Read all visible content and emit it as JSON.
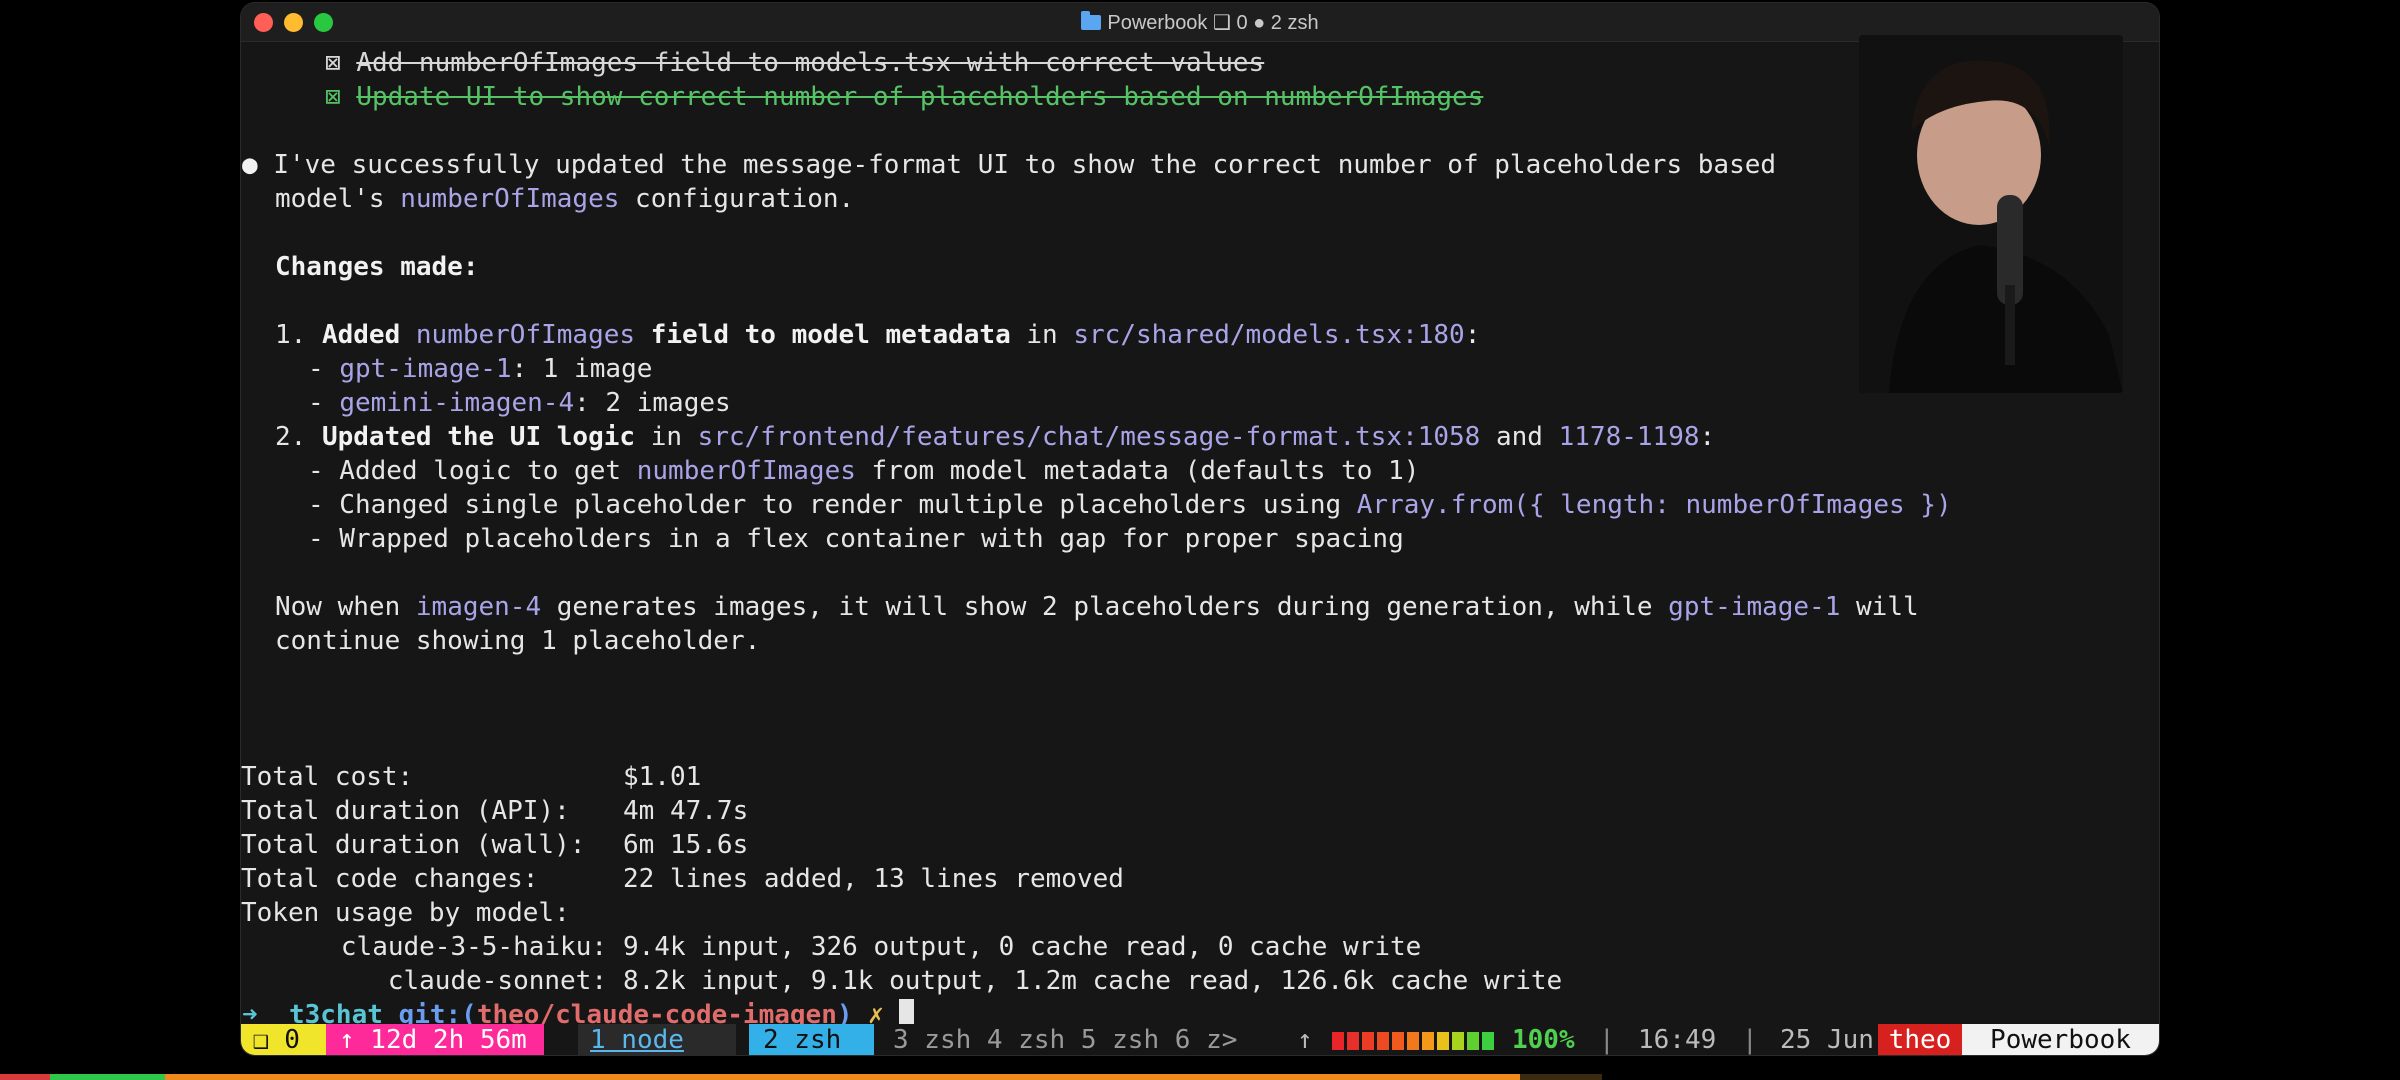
{
  "window": {
    "title": "Powerbook ❑ 0 ● 2 zsh",
    "title_name": "Powerbook",
    "title_rest": " ❑ 0 ● 2 zsh"
  },
  "todos": [
    {
      "check": "⊠",
      "text": "Add numberOfImages field to models.tsx with correct values"
    },
    {
      "check": "⊠",
      "text": "Update UI to show correct number of placeholders based on numberOfImages"
    }
  ],
  "message": {
    "bullet": "●",
    "line1": "I've successfully updated the message-format UI to show the correct number of placeholders based",
    "line2_a": "model's ",
    "line2_code": "numberOfImages",
    "line2_b": " configuration.",
    "changes_heading": "Changes made:",
    "item1_num": "1. ",
    "item1_a": "Added ",
    "item1_code": "numberOfImages",
    "item1_b": " field to model metadata",
    "item1_c": " in ",
    "item1_path": "src/shared/models.tsx:180",
    "item1_d": ":",
    "sub1_1_a": "- ",
    "sub1_1_code": "gpt-image-1",
    "sub1_1_b": ": 1 image",
    "sub1_2_a": "- ",
    "sub1_2_code": "gemini-imagen-4",
    "sub1_2_b": ": 2 images",
    "item2_num": "2. ",
    "item2_a": "Updated the UI logic",
    "item2_b": " in ",
    "item2_path": "src/frontend/features/chat/message-format.tsx:1058",
    "item2_c": " and ",
    "item2_range": "1178-1198",
    "item2_d": ":",
    "sub2_1_a": "- Added logic to get ",
    "sub2_1_code": "numberOfImages",
    "sub2_1_b": " from model metadata (defaults to 1)",
    "sub2_2_a": "- Changed single placeholder to render multiple placeholders using ",
    "sub2_2_code": "Array.from({ length: numberOfImages })",
    "sub2_3": "- Wrapped placeholders in a flex container with gap for proper spacing",
    "now_a": "Now when ",
    "now_code1": "imagen-4",
    "now_b": " generates images, it will show 2 placeholders during generation, while ",
    "now_code2": "gpt-image-1",
    "now_c": " will",
    "now_line2": "continue showing 1 placeholder."
  },
  "stats": {
    "cost_label": "Total cost:",
    "cost_value": "$1.01",
    "api_label": "Total duration (API):",
    "api_value": "4m 47.7s",
    "wall_label": "Total duration (wall):",
    "wall_value": "6m 15.6s",
    "changes_label": "Total code changes:",
    "changes_value": "22 lines added, 13 lines removed",
    "usage_label": "Token usage by model:",
    "models": [
      {
        "name": "claude-3-5-haiku:",
        "usage": "9.4k input, 326 output, 0 cache read, 0 cache write"
      },
      {
        "name": "claude-sonnet:",
        "usage": "8.2k input, 9.1k output, 1.2m cache read, 126.6k cache write"
      }
    ]
  },
  "prompt": {
    "arrow": "➜",
    "dir": "t3chat",
    "git": "git:(",
    "branch": "theo/claude-code-imagen",
    "git_close": ")",
    "dirty": "✗"
  },
  "statusbar": {
    "session": "❑ 0",
    "uptime": "↑ 12d 2h 56m",
    "window1": "1 node",
    "window2": "2 zsh",
    "windows_rest": "3 zsh 4 zsh 5 zsh 6 z>",
    "up_arrow": "↑",
    "battery": "100%",
    "sep": "|",
    "time": "16:49",
    "date": "25 Jun",
    "user": "theo",
    "host": "Powerbook",
    "battery_level": 1.0
  },
  "colors": {
    "accent_yellow": "#f0e52b",
    "accent_pink": "#ff2a9a",
    "accent_blue": "#33b0e8",
    "user_red": "#d6211f",
    "link_purple": "#a9a4e8",
    "todo_green": "#56c266"
  }
}
